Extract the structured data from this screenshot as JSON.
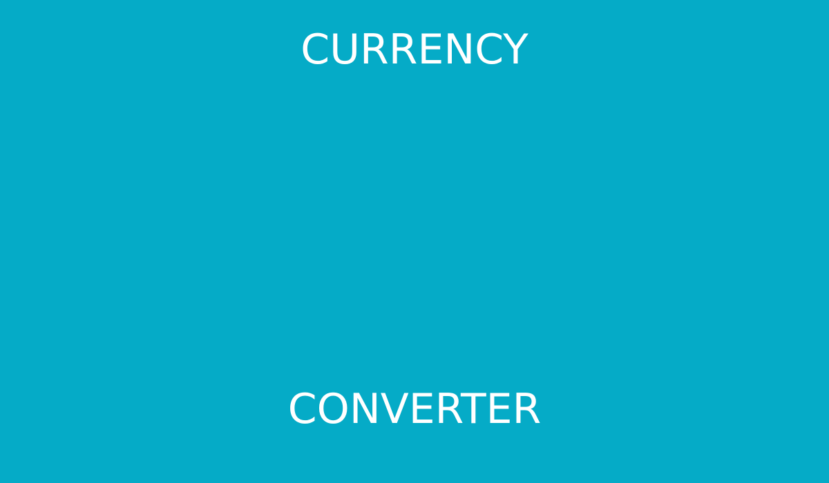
{
  "splash": {
    "title_line_1": "CURRENCY",
    "title_line_2": "CONVERTER"
  },
  "colors": {
    "background": "#05abc7",
    "text": "#ffffff"
  }
}
